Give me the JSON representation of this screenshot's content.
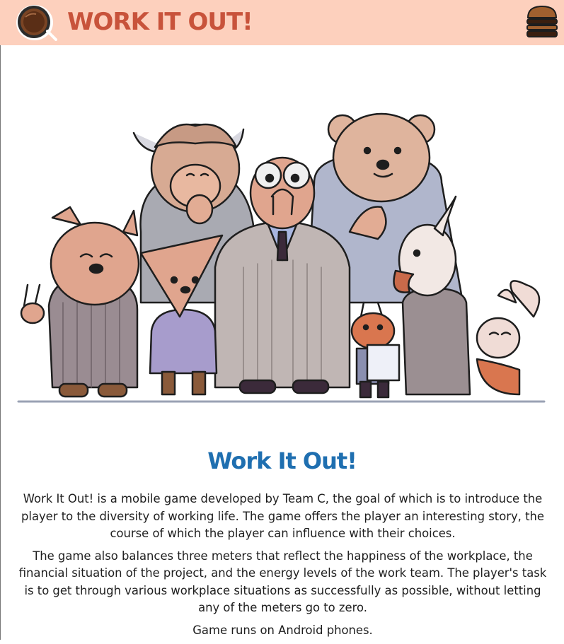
{
  "header": {
    "title": "WORK IT OUT!",
    "logo_icon": "coffee-cup-icon",
    "menu_icon": "hamburger-menu-icon",
    "background": "#fdd0bd",
    "title_color": "#c8533b"
  },
  "main": {
    "hero_image": "group-of-animal-office-workers-illustration",
    "title": "Work It Out!",
    "title_color": "#1f6fb0",
    "paragraphs": [
      "Work It Out! is a mobile game developed by Team C, the goal of which is to introduce the player to the diversity of working life. The game offers the player an interesting story, the course of which the player can influence with their choices.",
      "The game also balances three meters that reflect the happiness of the workplace, the financial situation of the project, and the energy levels of the work team. The player's task is to get through various workplace situations as successfully as possible, without letting any of the meters go to zero.",
      "Game runs on Android phones."
    ]
  }
}
